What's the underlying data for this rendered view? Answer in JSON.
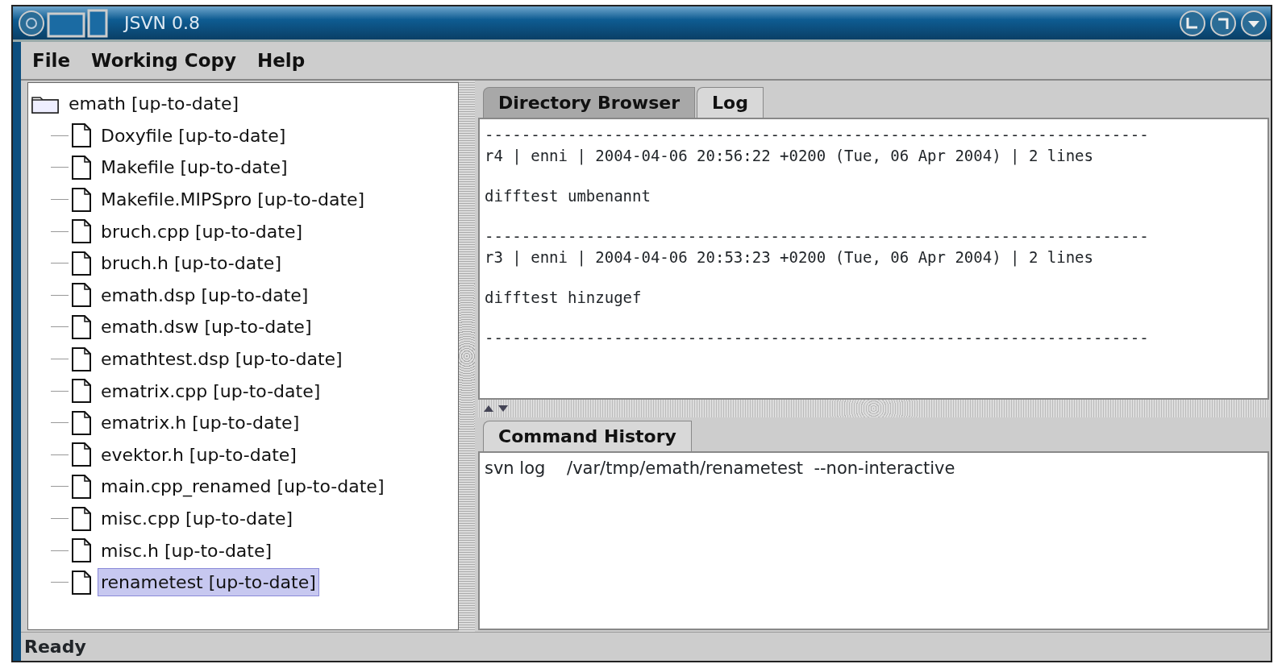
{
  "window": {
    "title": "JSVN 0.8"
  },
  "menu": [
    "File",
    "Working Copy",
    "Help"
  ],
  "tree": {
    "label": "emath  [up-to-date]",
    "selected": false,
    "children": [
      {
        "label": "Doxyfile  [up-to-date]",
        "selected": false
      },
      {
        "label": "Makefile  [up-to-date]",
        "selected": false
      },
      {
        "label": "Makefile.MIPSpro  [up-to-date]",
        "selected": false
      },
      {
        "label": "bruch.cpp  [up-to-date]",
        "selected": false
      },
      {
        "label": "bruch.h  [up-to-date]",
        "selected": false
      },
      {
        "label": "emath.dsp  [up-to-date]",
        "selected": false
      },
      {
        "label": "emath.dsw  [up-to-date]",
        "selected": false
      },
      {
        "label": "emathtest.dsp  [up-to-date]",
        "selected": false
      },
      {
        "label": "ematrix.cpp  [up-to-date]",
        "selected": false
      },
      {
        "label": "ematrix.h  [up-to-date]",
        "selected": false
      },
      {
        "label": "evektor.h  [up-to-date]",
        "selected": false
      },
      {
        "label": "main.cpp_renamed  [up-to-date]",
        "selected": false
      },
      {
        "label": "misc.cpp  [up-to-date]",
        "selected": false
      },
      {
        "label": "misc.h  [up-to-date]",
        "selected": false
      },
      {
        "label": "renametest  [up-to-date]",
        "selected": true
      }
    ]
  },
  "tabs": [
    {
      "label": "Directory Browser",
      "selected": false
    },
    {
      "label": "Log",
      "selected": true
    }
  ],
  "log": [
    {
      "kind": "rule",
      "text": "------------------------------------------------------------------------"
    },
    {
      "kind": "header",
      "text": "r4 | enni | 2004-04-06 20:56:22 +0200 (Tue, 06 Apr 2004) | 2 lines"
    },
    {
      "kind": "message",
      "text": "difftest umbenannt"
    },
    {
      "kind": "rule",
      "text": "------------------------------------------------------------------------"
    },
    {
      "kind": "header",
      "text": "r3 | enni | 2004-04-06 20:53:23 +0200 (Tue, 06 Apr 2004) | 2 lines"
    },
    {
      "kind": "message",
      "text": "difftest hinzugef"
    },
    {
      "kind": "rule",
      "text": "------------------------------------------------------------------------"
    }
  ],
  "history_tabs": [
    {
      "label": "Command History",
      "selected": true
    }
  ],
  "history": [
    "svn log    /var/tmp/emath/renametest  --non-interactive"
  ],
  "status_bar": "Ready"
}
